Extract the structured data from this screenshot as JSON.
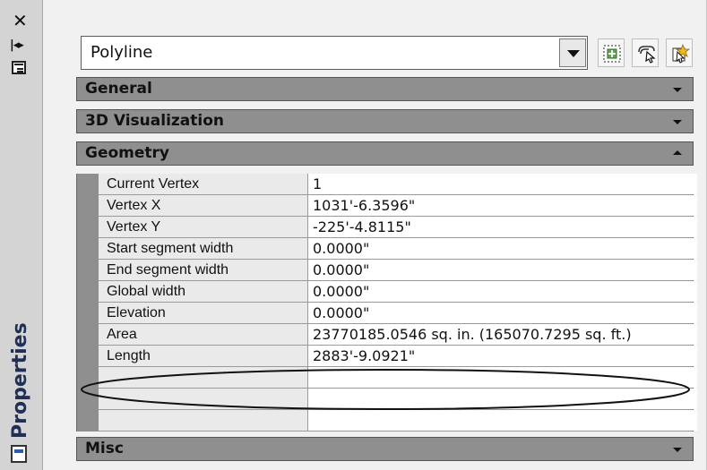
{
  "sidebar": {
    "title": "Properties",
    "close_icon": "close-icon",
    "autohide_icon": "auto-hide-icon",
    "menu_icon": "properties-menu-icon",
    "bottom_icon": "palette-icon"
  },
  "selector": {
    "value": "Polyline"
  },
  "toolbar": {
    "icons": [
      "toggle-pickadd-icon",
      "select-objects-icon",
      "quick-select-icon"
    ]
  },
  "sections": [
    {
      "label": "General",
      "state": "collapsed"
    },
    {
      "label": "3D Visualization",
      "state": "collapsed"
    },
    {
      "label": "Geometry",
      "state": "expanded"
    },
    {
      "label": "Misc",
      "state": "collapsed"
    }
  ],
  "geometry_rows": [
    {
      "label": "Current Vertex",
      "value": "1"
    },
    {
      "label": "Vertex X",
      "value": "1031'-6.3596\""
    },
    {
      "label": "Vertex Y",
      "value": "-225'-4.8115\""
    },
    {
      "label": "Start segment width",
      "value": "0.0000\""
    },
    {
      "label": "End segment width",
      "value": "0.0000\""
    },
    {
      "label": "Global width",
      "value": "0.0000\""
    },
    {
      "label": "Elevation",
      "value": "0.0000\""
    },
    {
      "label": "Area",
      "value": "23770185.0546 sq. in. (165070.7295 sq. ft.)"
    },
    {
      "label": "Length",
      "value": "2883'-9.0921\""
    },
    {
      "label": "",
      "value": ""
    },
    {
      "label": "",
      "value": ""
    },
    {
      "label": "",
      "value": ""
    }
  ],
  "colors": {
    "section_header": "#8f8f8f",
    "label_background": "#eaeaea",
    "value_background": "#ffffff",
    "title_text": "#1f2f55"
  }
}
